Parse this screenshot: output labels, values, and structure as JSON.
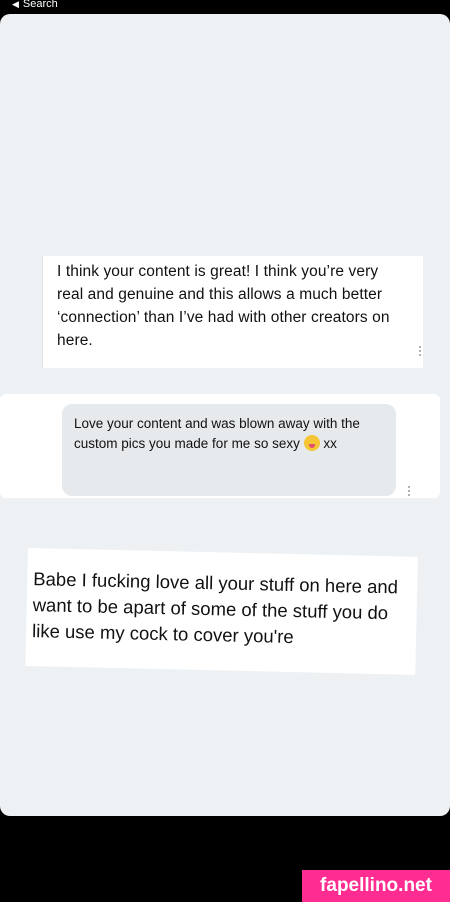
{
  "status_bar": {
    "back_label": "Search"
  },
  "messages": [
    {
      "text": "I think your content is great! I think you’re very real and genuine and this allows a much better ‘connection’ than I’ve had with other creators on here."
    },
    {
      "text_before_emoji": "Love your content and was blown away with the custom pics you made for me so sexy",
      "emoji": "winking-tongue-emoji",
      "text_after_emoji": "xx"
    },
    {
      "text": "Babe I fucking love all your stuff on here and want to be apart of some of the stuff you do like use my cock to cover you're"
    }
  ],
  "watermark": "fapellino.net"
}
